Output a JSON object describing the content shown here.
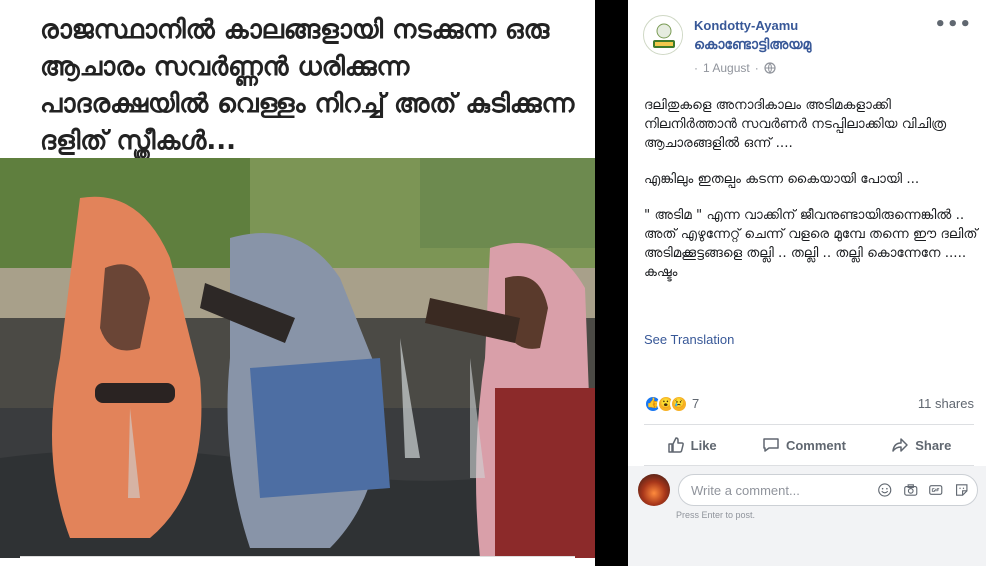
{
  "photo_panel": {
    "caption": "രാജസ്ഥാനിൽ കാലങ്ങളായി നടക്കുന്ന ഒരു ആചാരം സവർണ്ണൻ ധരിക്കുന്ന പാദരക്ഷയിൽ വെള്ളം നിറച്ച് അത് കുടിക്കുന്ന ദളിത് സ്ത്രീകൾ..."
  },
  "post": {
    "author_name": "Kondotty-Ayamu",
    "author_name_alt": "കൊണ്ടോട്ടിഅയമു",
    "date": "1 August",
    "privacy_icon": "globe-icon",
    "more_icon": "more-horizontal-icon",
    "body": {
      "p1": "ദലിതുകളെ അനാദികാലം അടിമകളാക്കി നിലനിർത്താൻ സവർണർ നടപ്പിലാക്കിയ വിചിത്ര ആചാരങ്ങളിൽ ഒന്ന് ....",
      "p2": "എങ്കിലും ഇതല്പം കടന്ന കൈയായി പോയി ...",
      "p3": "\" അടിമ \" എന്ന വാക്കിന് ജീവനുണ്ടായിരുന്നെങ്കിൽ .. അത് എഴുന്നേറ്റ് ചെന്ന് വളരെ മുമ്പേ തന്നെ ഈ ദലിത് അടിമക്കൂട്ടങ്ങളെ തല്ലി .. തല്ലി .. തല്ലി കൊന്നേനേ .....\nകഷ്ടം"
    },
    "see_translation": "See Translation",
    "reactions_count": "7",
    "shares": "11 shares",
    "actions": {
      "like": "Like",
      "comment": "Comment",
      "share": "Share"
    },
    "comment_placeholder": "Write a comment...",
    "press_enter": "Press Enter to post."
  },
  "colors": {
    "link_blue": "#385898",
    "like_blue": "#1877f2",
    "meta_gray": "#90949c",
    "action_gray": "#606770"
  }
}
